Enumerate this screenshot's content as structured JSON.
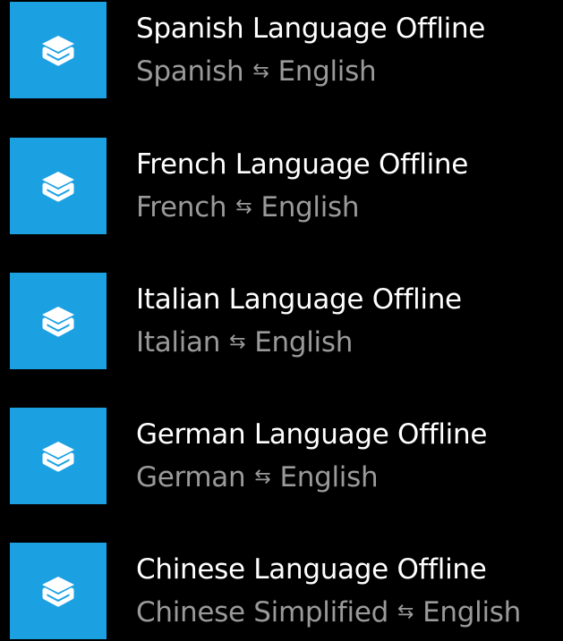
{
  "colors": {
    "background": "#000000",
    "tile": "#1ba1e2",
    "title_text": "#ffffff",
    "subtitle_text": "#9a9a9a"
  },
  "icons": {
    "tile_icon": "book-stack-icon",
    "direction_icon": "swap-arrows-icon",
    "direction_glyph": "⇆"
  },
  "items": [
    {
      "title": "Spanish Language Offline",
      "from": "Spanish",
      "to": "English"
    },
    {
      "title": "French Language Offline",
      "from": "French",
      "to": "English"
    },
    {
      "title": "Italian Language Offline",
      "from": "Italian",
      "to": "English"
    },
    {
      "title": "German Language Offline",
      "from": "German",
      "to": "English"
    },
    {
      "title": "Chinese Language Offline",
      "from": "Chinese Simplified",
      "to": "English"
    }
  ]
}
